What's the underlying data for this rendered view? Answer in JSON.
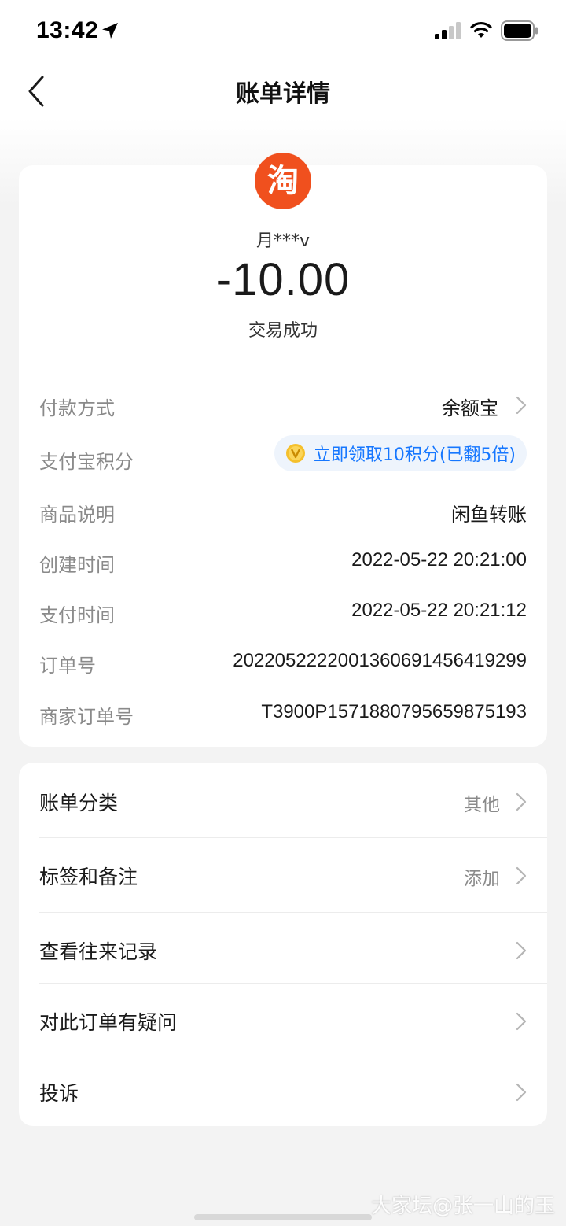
{
  "status_bar": {
    "time": "13:42"
  },
  "header": {
    "title": "账单详情"
  },
  "summary": {
    "merchant_logo_text": "淘",
    "counterparty": "月***v",
    "amount": "-10.00",
    "status": "交易成功"
  },
  "details": [
    {
      "label": "付款方式",
      "value": "余额宝"
    },
    {
      "label": "支付宝积分",
      "value": "立即领取10积分(已翻5倍)"
    },
    {
      "label": "商品说明",
      "value": "闲鱼转账"
    },
    {
      "label": "创建时间",
      "value": "2022-05-22 20:21:00"
    },
    {
      "label": "支付时间",
      "value": "2022-05-22 20:21:12"
    },
    {
      "label": "订单号",
      "value": "2022052222001360691456419299"
    },
    {
      "label": "商家订单号",
      "value": "T3900P1571880795659875193"
    }
  ],
  "actions": [
    {
      "label": "账单分类",
      "value": "其他"
    },
    {
      "label": "标签和备注",
      "value": "添加"
    },
    {
      "label": "查看往来记录"
    },
    {
      "label": "对此订单有疑问"
    },
    {
      "label": "投诉"
    }
  ],
  "watermark": "大家坛@张一山的玉",
  "colors": {
    "brand_orange": "#f0501e",
    "link_blue": "#1677ff",
    "points_bg": "#eef4fc",
    "coin_gold": "#f5c02c"
  }
}
